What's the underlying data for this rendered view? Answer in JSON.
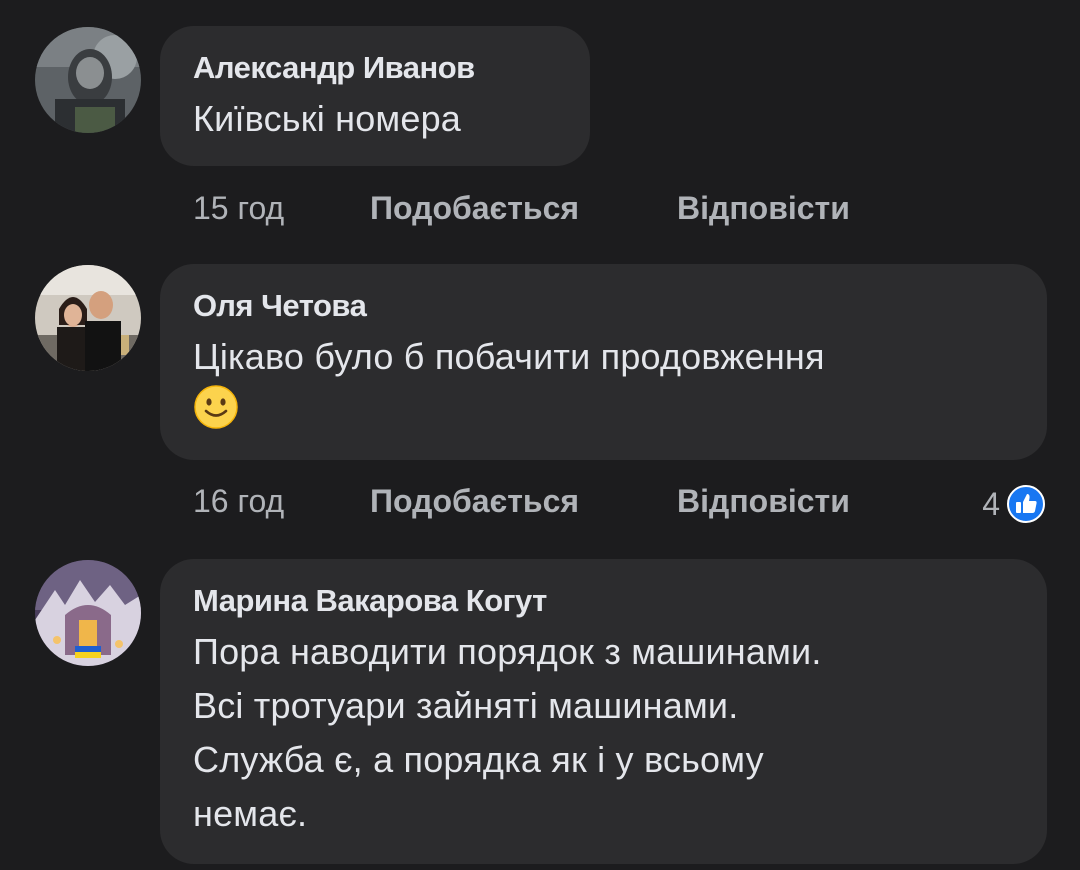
{
  "comments": [
    {
      "author": "Александр Иванов",
      "lines": [
        "Київські номера"
      ],
      "time": "15 год",
      "like_label": "Подобається",
      "reply_label": "Відповісти",
      "reactions": null
    },
    {
      "author": "Оля Четова",
      "lines": [
        "Цікаво було б побачити продовження"
      ],
      "emoji": "slightly-smiling-face-icon",
      "time": "16 год",
      "like_label": "Подобається",
      "reply_label": "Відповісти",
      "reactions": {
        "count": "4",
        "icon": "like-reaction-icon",
        "color": "#1877f2"
      }
    },
    {
      "author": "Марина Вакарова Когут",
      "lines": [
        "Пора наводити порядок з машинами.",
        "Всі тротуари зайняті машинами.",
        "Служба є, а порядка як і у всьому",
        "немає."
      ]
    }
  ],
  "colors": {
    "background": "#1c1c1e",
    "bubble": "#2c2c2e",
    "primary_text": "#e4e6eb",
    "secondary_text": "#b0b3b8"
  }
}
